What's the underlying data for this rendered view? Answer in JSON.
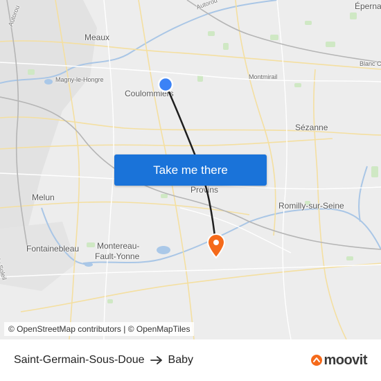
{
  "map": {
    "labels": {
      "epernay": "Épernay",
      "meaux": "Meaux",
      "magny": "Magny-le-Hongre",
      "coulommiers": "Coulommiers",
      "montmirail": "Montmirail",
      "blanc": "Blanc C",
      "sezanne": "Sézanne",
      "provins": "Provins",
      "romilly": "Romilly-sur-Seine",
      "melun": "Melun",
      "fontainebleau": "Fontainebleau",
      "montereau_1": "Montereau-",
      "montereau_2": "Fault-Yonne",
      "autoroute_soleil": "Autoroute du Soleil",
      "autoroute_top": "Autorou",
      "autoroute_left": "Autorou"
    },
    "origin_color": "#3b82f6",
    "destination_color": "#f56a1a"
  },
  "cta": {
    "label": "Take me there",
    "color": "#1a73d9"
  },
  "attribution": "© OpenStreetMap contributors | © OpenMapTiles",
  "footer": {
    "from": "Saint-Germain-Sous-Doue",
    "to": "Baby",
    "arrow_icon": "arrow-right-icon",
    "brand": "moovit",
    "brand_color": "#f56a1a"
  }
}
